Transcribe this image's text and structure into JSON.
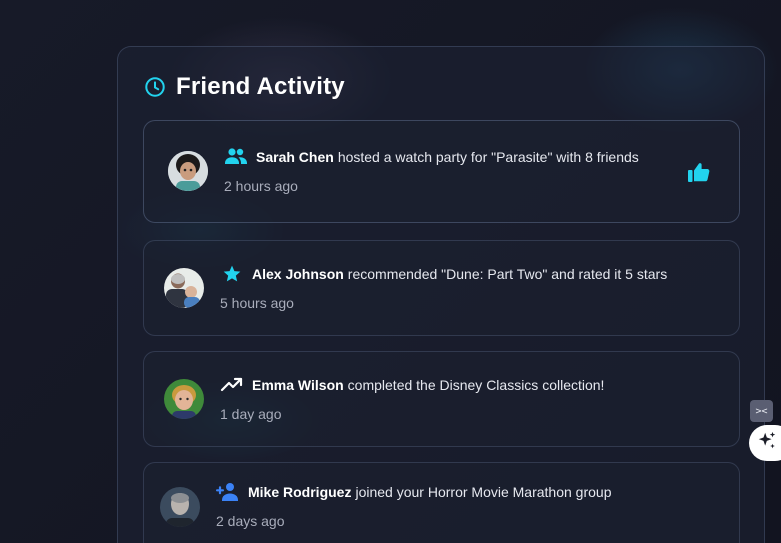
{
  "header": {
    "title": "Friend Activity",
    "icon": "clock-icon",
    "accent_color": "#22d3ee"
  },
  "activities": [
    {
      "icon": "users-icon",
      "icon_color": "#22d3ee",
      "user": "Sarah Chen",
      "action": "hosted a watch party for \"Parasite\" with 8 friends",
      "time": "2 hours ago",
      "liked": true,
      "like_icon": "thumbs-up-icon"
    },
    {
      "icon": "star-icon",
      "icon_color": "#22d3ee",
      "user": "Alex Johnson",
      "action": "recommended \"Dune: Part Two\" and rated it 5 stars",
      "time": "5 hours ago"
    },
    {
      "icon": "trending-up-icon",
      "icon_color": "#ffffff",
      "user": "Emma Wilson",
      "action": "completed the Disney Classics collection!",
      "time": "1 day ago"
    },
    {
      "icon": "user-plus-icon",
      "icon_color": "#3b82f6",
      "user": "Mike Rodriguez",
      "action": "joined your Horror Movie Marathon group",
      "time": "2 days ago"
    }
  ],
  "floating": {
    "code_button_icon": "code-icon",
    "ai_button_icon": "sparkles-icon"
  }
}
